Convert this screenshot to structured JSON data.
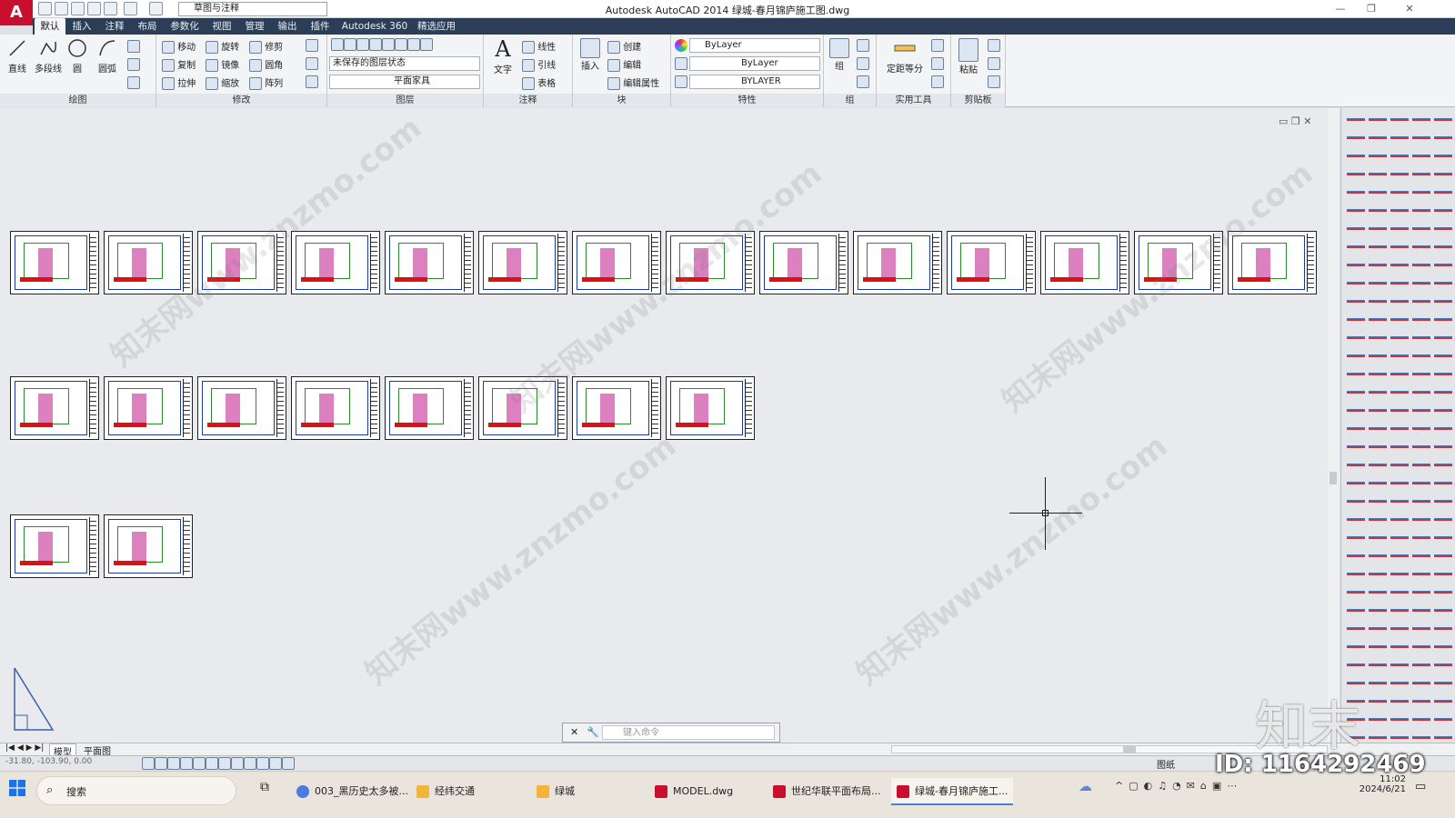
{
  "app": {
    "logo": "A",
    "window_title": "Autodesk AutoCAD 2014    绿城-春月锦庐施工图.dwg",
    "workspace": "草图与注释"
  },
  "tabs": [
    "默认",
    "插入",
    "注释",
    "布局",
    "参数化",
    "视图",
    "管理",
    "输出",
    "插件",
    "Autodesk 360",
    "精选应用"
  ],
  "ribbon": {
    "draw": {
      "title": "绘图",
      "line": "直线",
      "polyline": "多段线",
      "circle": "圆",
      "arc": "圆弧"
    },
    "modify": {
      "title": "修改",
      "move": "移动",
      "rotate": "旋转",
      "trim": "修剪",
      "copy": "复制",
      "mirror": "镜像",
      "fillet": "圆角",
      "stretch": "拉伸",
      "scale": "缩放",
      "array": "阵列"
    },
    "layers": {
      "title": "图层",
      "state": "未保存的图层状态",
      "current": "平面家具"
    },
    "annotation": {
      "title": "注释",
      "text": "文字",
      "linear": "线性",
      "leader": "引线",
      "table": "表格"
    },
    "block": {
      "title": "块",
      "insert": "插入",
      "create": "创建",
      "edit": "编辑",
      "edit_attr": "编辑属性"
    },
    "properties": {
      "title": "特性",
      "color": "ByLayer",
      "linetype": "ByLayer",
      "lineweight": "BYLAYER"
    },
    "groups": {
      "title": "组",
      "group": "组"
    },
    "utilities": {
      "title": "实用工具",
      "measure": "定距等分"
    },
    "clipboard": {
      "title": "剪贴板",
      "paste": "粘贴"
    }
  },
  "canvas": {
    "watermark": "知末网www.znzmo.com",
    "row1_count": 14,
    "row2_count": 8,
    "row3_count": 2
  },
  "command": {
    "placeholder": "键入命令"
  },
  "layout_tabs": [
    "模型",
    "平面图"
  ],
  "status": {
    "coords": "-31.80, -103.90, 0.00",
    "paper": "图纸"
  },
  "taskbar": {
    "search": "搜索",
    "items": [
      "003_黑历史太多被...",
      "经纬交通",
      "绿城",
      "MODEL.dwg",
      "世纪华联平面布局...",
      "绿城-春月锦庐施工..."
    ],
    "time": "11:02",
    "date": "2024/6/21"
  },
  "brand": {
    "logo": "知末",
    "id": "ID: 1164292469"
  }
}
